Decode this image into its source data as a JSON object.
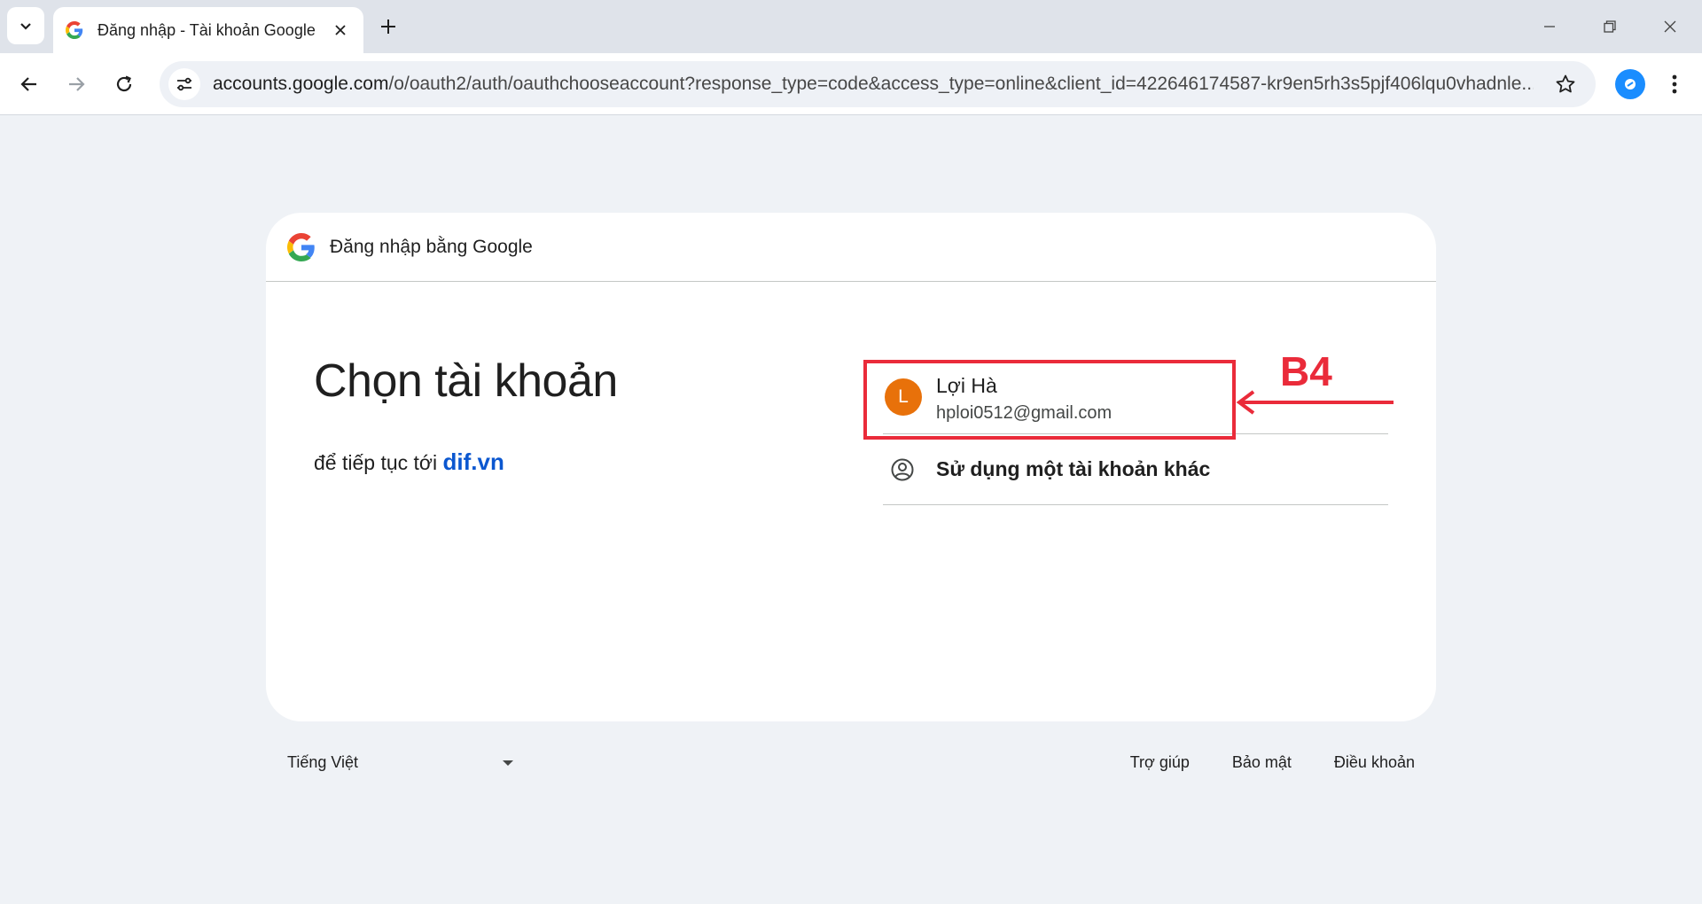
{
  "browser": {
    "tab_title": "Đăng nhập - Tài khoản Google",
    "url_host": "accounts.google.com",
    "url_path": "/o/oauth2/auth/oauthchooseaccount?response_type=code&access_type=online&client_id=422646174587-kr9en5rh3s5pjf406lqu0vhadnle..."
  },
  "card": {
    "header_title": "Đăng nhập bằng Google",
    "headline": "Chọn tài khoản",
    "subline_prefix": "để tiếp tục tới",
    "destination": "dif.vn",
    "account": {
      "initial": "L",
      "name": "Lợi Hà",
      "email": "hploi0512@gmail.com"
    },
    "other_account_label": "Sử dụng một tài khoản khác"
  },
  "annotation": {
    "step_label": "B4",
    "color": "#ea2b3a"
  },
  "footer": {
    "language": "Tiếng Việt",
    "links": [
      "Trợ giúp",
      "Bảo mật",
      "Điều khoản"
    ]
  },
  "colors": {
    "avatar": "#e8710a",
    "link_blue": "#0b57d0",
    "page_bg": "#eff2f6"
  }
}
